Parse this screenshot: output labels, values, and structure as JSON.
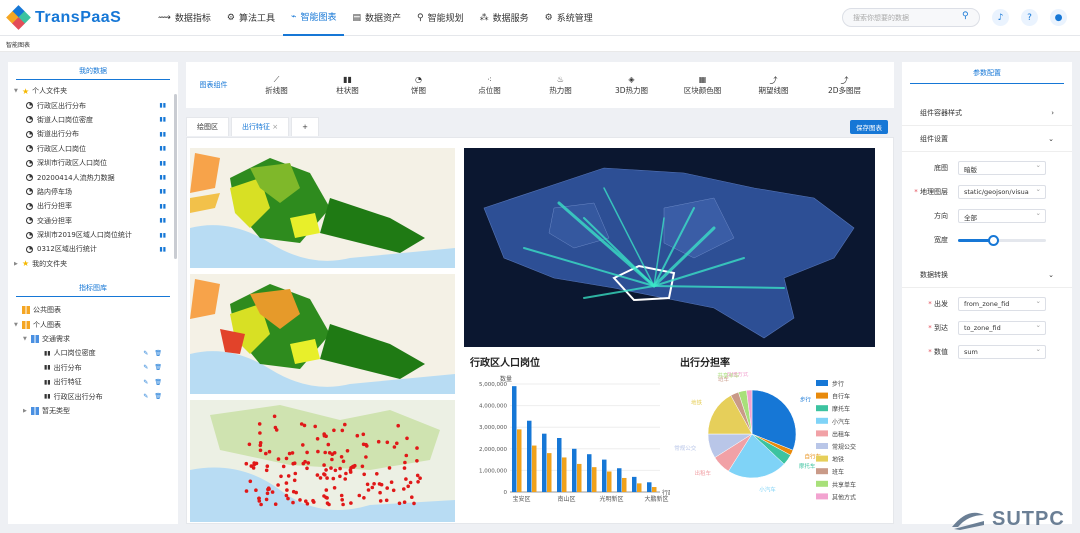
{
  "app": {
    "name": "TransPaaS"
  },
  "nav": [
    {
      "label": "数据指标",
      "icon": "⟿"
    },
    {
      "label": "算法工具",
      "icon": "⚙"
    },
    {
      "label": "智能图表",
      "icon": "⌁"
    },
    {
      "label": "数据资产",
      "icon": "▤"
    },
    {
      "label": "智能规划",
      "icon": "⚲"
    },
    {
      "label": "数据服务",
      "icon": "⁂"
    },
    {
      "label": "系统管理",
      "icon": "⚙"
    }
  ],
  "search": {
    "placeholder": "搜索你想要的数据"
  },
  "breadcrumb": "智能图表",
  "left": {
    "my_data_title": "我的数据",
    "personal_folder": "个人文件夹",
    "items": [
      "行政区出行分布",
      "街道人口岗位密度",
      "街道出行分布",
      "行政区人口岗位",
      "深圳市行政区人口岗位",
      "20200414人流热力数据",
      "路内停车场",
      "出行分担率",
      "交通分担率",
      "深圳市2019区域人口岗位统计",
      "0312区域出行统计"
    ],
    "my_files": "我的文件夹",
    "library_title": "指标图库",
    "public": "公共图表",
    "personal": "个人图表",
    "traffic": "交通需求",
    "charts": [
      "人口岗位密度",
      "出行分布",
      "出行特征",
      "行政区出行分布"
    ],
    "none": "暂无类型"
  },
  "toolbar": {
    "label": "图表组件",
    "items": [
      "折线图",
      "柱状图",
      "饼图",
      "点位图",
      "热力图",
      "3D热力图",
      "区块颜色图",
      "期望线图",
      "2D多图层"
    ]
  },
  "tabs": [
    "绘图区",
    "出行特征"
  ],
  "save": "保存图表",
  "bar_card": {
    "title": "行政区人口岗位",
    "ylabel": "数量",
    "yticks": [
      "5,000,000",
      "4,000,000",
      "3,000,000",
      "2,000,000",
      "1,000,000",
      "0"
    ],
    "xticks": [
      "宝安区",
      "南山区",
      "光明新区",
      "大鹏新区"
    ],
    "xlabel": "行政"
  },
  "pie_card": {
    "title": "出行分担率"
  },
  "chart_data": [
    {
      "type": "bar",
      "title": "行政区人口岗位",
      "ylabel": "数量",
      "ylim": [
        0,
        5000000
      ],
      "series": [
        {
          "color": "#1677d6",
          "values": [
            4900000,
            3300000,
            2700000,
            2500000,
            2000000,
            1750000,
            1500000,
            1100000,
            700000,
            450000
          ]
        },
        {
          "color": "#f0a21c",
          "values": [
            2900000,
            2150000,
            1800000,
            1600000,
            1300000,
            1150000,
            950000,
            650000,
            400000,
            230000
          ]
        }
      ]
    },
    {
      "type": "pie",
      "title": "出行分担率",
      "slices": [
        {
          "name": "步行",
          "value": 31,
          "color": "#1677d6"
        },
        {
          "name": "自行车",
          "value": 2,
          "color": "#e88a0c"
        },
        {
          "name": "摩托车",
          "value": 4,
          "color": "#3cc3a0"
        },
        {
          "name": "小汽车",
          "value": 22,
          "color": "#7fd3f7"
        },
        {
          "name": "出租车",
          "value": 7,
          "color": "#f1a1a6"
        },
        {
          "name": "常规公交",
          "value": 9,
          "color": "#b9c6e8"
        },
        {
          "name": "地铁",
          "value": 17,
          "color": "#e6cf5a"
        },
        {
          "name": "班车",
          "value": 3,
          "color": "#c99a88"
        },
        {
          "name": "共享单车",
          "value": 3,
          "color": "#a8e07a"
        },
        {
          "name": "其他方式",
          "value": 2,
          "color": "#f2a3d0"
        }
      ]
    }
  ],
  "pie_labels": [
    "其他方式",
    "共享单车",
    "班车",
    "地铁",
    "常规公交",
    "出租车",
    "小汽车",
    "摩托车",
    "自行车",
    "步行"
  ],
  "right": {
    "title": "参数配置",
    "container": "组件容器样式",
    "settings": "组件设置",
    "rows": [
      {
        "label": "底图",
        "value": "暗版",
        "req": false
      },
      {
        "label": "地理图层",
        "value": "static/geojson/visua",
        "req": true
      },
      {
        "label": "方向",
        "value": "全部",
        "req": false
      }
    ],
    "width_label": "宽度",
    "width_value": 0.4,
    "convert": "数据转换",
    "rows2": [
      {
        "label": "出发",
        "value": "from_zone_fid"
      },
      {
        "label": "到达",
        "value": "to_zone_fid"
      },
      {
        "label": "数值",
        "value": "sum"
      }
    ]
  },
  "watermark": "SUTPC",
  "colors": {
    "accent": "#1677d6"
  }
}
